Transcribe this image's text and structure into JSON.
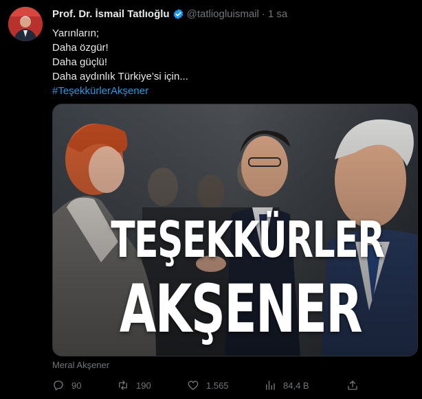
{
  "author": {
    "name": "Prof. Dr. İsmail Tatlıoğlu",
    "handle": "@tatliogluismail",
    "separator": "·",
    "time": "1 sa",
    "verified_color": "#1d9bf0"
  },
  "tweet": {
    "lines": [
      "Yarınların;",
      "Daha özgür!",
      "Daha güçlü!",
      "Daha aydınlık Türkiye’si için..."
    ],
    "hashtag": "#TeşekkürlerAkşener"
  },
  "media": {
    "overlay_line_1": "TEŞEKKÜRLER",
    "overlay_line_2": "AKŞENER"
  },
  "tagged": "Meral Akşener",
  "actions": {
    "replies": "90",
    "retweets": "190",
    "likes": "1.565",
    "views": "84,4 B"
  },
  "icons": {
    "reply": "reply-icon",
    "retweet": "retweet-icon",
    "like": "heart-icon",
    "views": "analytics-icon",
    "share": "share-icon",
    "verified": "verified-badge-icon"
  },
  "colors": {
    "background": "#000000",
    "text": "#e7e9ea",
    "muted": "#71767b",
    "accent": "#1d9bf0"
  }
}
